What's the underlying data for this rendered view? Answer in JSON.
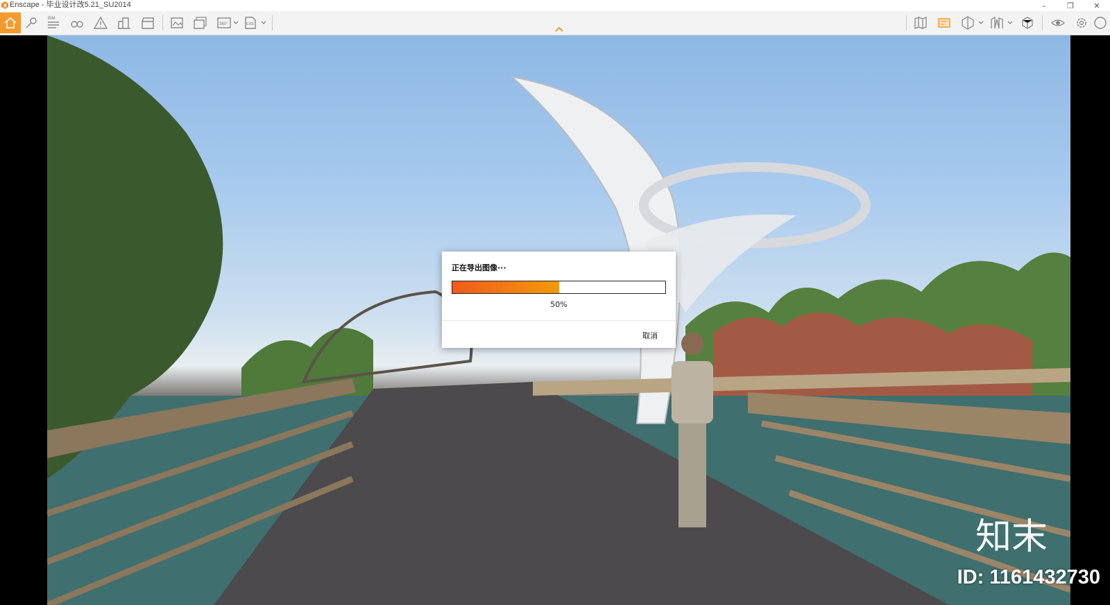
{
  "window": {
    "title": "Enscape - 毕业设计改5.21_SU2014",
    "controls": [
      "minimize-icon",
      "restore-icon",
      "close-icon"
    ]
  },
  "toolbar": {
    "left_icons": [
      "home-icon",
      "pin-icon",
      "bim-icon",
      "binoculars-icon",
      "warning-icon",
      "buildings-icon",
      "clapperboard-icon",
      "screenshot-export-icon",
      "batch-export-icon",
      "panorama-360-icon",
      "exe-export-icon"
    ],
    "bim_label": "BIM",
    "pano_label": "360°",
    "exe_label": "EXE",
    "right_icons": [
      "map-icon",
      "views-icon",
      "section-icon",
      "asset-library-icon",
      "material-icon",
      "visual-settings-icon",
      "settings-icon",
      "help-icon"
    ],
    "accent_color": "#f59b2d"
  },
  "dialog": {
    "message": "正在导出图像···",
    "progress": 0.5,
    "percent_label": "50%",
    "cancel_label": "取消",
    "bar_colors": [
      "#f05a1c",
      "#f39a0a"
    ]
  },
  "watermark": {
    "id_text": "ID: 1161432730",
    "logo_text": "知末"
  }
}
